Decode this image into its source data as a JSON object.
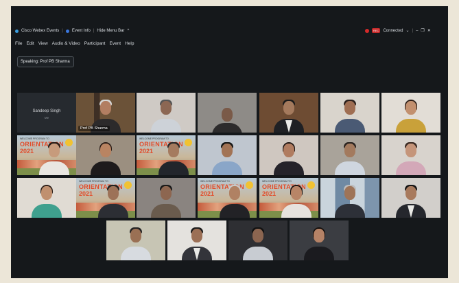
{
  "titlebar": {
    "app_name": "Cisco Webex Events",
    "event_info": "Event Info",
    "hide_menu_bar": "Hide Menu Bar",
    "connected": "Connected"
  },
  "menu": {
    "items": [
      "File",
      "Edit",
      "View",
      "Audio & Video",
      "Participant",
      "Event",
      "Help"
    ]
  },
  "speaking": "Speaking: Prof PB Sharma",
  "participants": {
    "sandeep": {
      "name": "Sandeep Singh",
      "sub": "Me"
    },
    "active_label": "Prof PB Sharma"
  },
  "banner": {
    "line1": "WELCOME PROGRAM TO",
    "line2": "ORIENTATION",
    "line3": "2021"
  },
  "colors": {
    "active_outline": "#2fa9c8",
    "record": "#d42a2a",
    "background": "#15181b"
  }
}
